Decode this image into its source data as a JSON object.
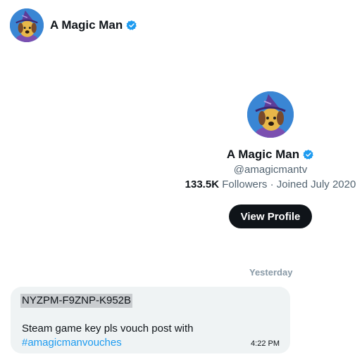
{
  "header": {
    "name": "A Magic Man",
    "avatar_icon": "wizard-dog-avatar-icon",
    "verified_icon": "verified-badge-icon"
  },
  "profile": {
    "name": "A Magic Man",
    "handle": "@amagicmantv",
    "followers_count": "133.5K",
    "followers_label": "Followers",
    "separator": "·",
    "joined": "Joined July 2020",
    "view_profile_label": "View Profile"
  },
  "conversation": {
    "date_label": "Yesterday",
    "message": {
      "highlighted_text": "NYZPM-F9ZNP-K952B",
      "body_text": "Steam game key pls vouch post with",
      "hashtag": "#amagicmanvouches",
      "time": "4:22 PM"
    }
  },
  "colors": {
    "accent": "#1d9bf0",
    "button_bg": "#0f1419",
    "bubble_bg": "#eff3f4",
    "muted_text": "#536471",
    "avatar_bg": "#3a86d4"
  }
}
